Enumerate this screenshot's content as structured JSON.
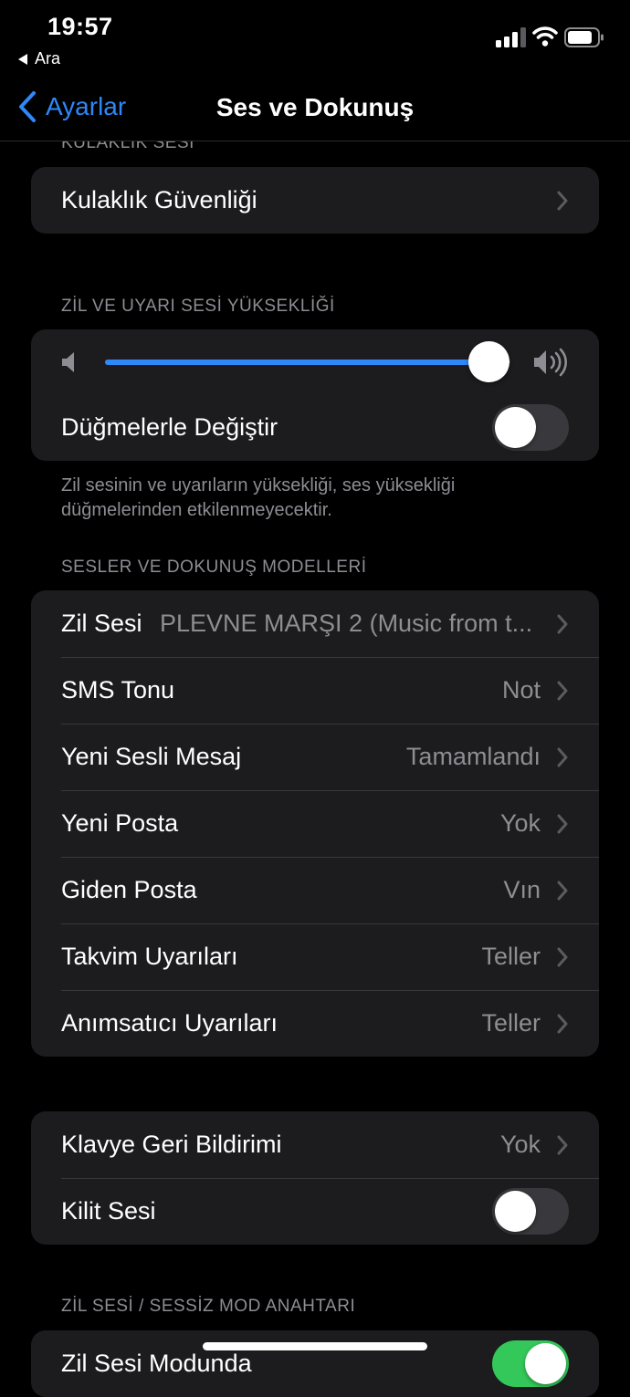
{
  "status": {
    "time": "19:57",
    "back_app": "Ara"
  },
  "nav": {
    "back_label": "Ayarlar",
    "title": "Ses ve Dokunuş"
  },
  "headphone": {
    "header": "KULAKLIK SESİ",
    "row_label": "Kulaklık Güvenliği"
  },
  "ringer": {
    "header": "ZİL VE UYARI SESİ YÜKSEKLİĞİ",
    "volume_fraction": 0.945,
    "change_with_buttons_label": "Düğmelerle Değiştir",
    "change_with_buttons_on": false,
    "footer": "Zil sesinin ve uyarıların yüksekliği, ses yüksekliği düğmelerinden etkilenmeyecektir."
  },
  "sounds": {
    "header": "SESLER VE DOKUNUŞ MODELLERİ",
    "items": [
      {
        "label": "Zil Sesi",
        "value": "PLEVNE MARŞI 2 (Music from t..."
      },
      {
        "label": "SMS Tonu",
        "value": "Not"
      },
      {
        "label": "Yeni Sesli Mesaj",
        "value": "Tamamlandı"
      },
      {
        "label": "Yeni Posta",
        "value": "Yok"
      },
      {
        "label": "Giden Posta",
        "value": "Vın"
      },
      {
        "label": "Takvim Uyarıları",
        "value": "Teller"
      },
      {
        "label": "Anımsatıcı Uyarıları",
        "value": "Teller"
      }
    ]
  },
  "keyboard": {
    "feedback_label": "Klavye Geri Bildirimi",
    "feedback_value": "Yok",
    "lock_sound_label": "Kilit Sesi",
    "lock_sound_on": false
  },
  "silent_switch": {
    "header": "ZİL SESİ / SESSİZ MOD ANAHTARI",
    "row_label": "Zil Sesi Modunda",
    "row_on": true
  },
  "colors": {
    "accent": "#2e88f7",
    "toggle_on": "#34c759",
    "toggle_off": "#39393d",
    "cell_bg": "#1c1c1e",
    "secondary_text": "#8d8d93"
  }
}
